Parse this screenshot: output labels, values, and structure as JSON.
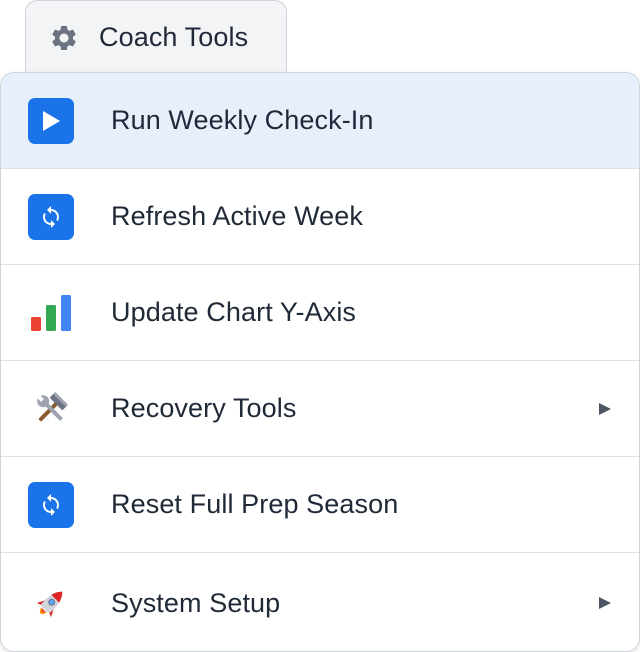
{
  "menu": {
    "title": "Coach Tools",
    "icon": "gear-icon"
  },
  "items": [
    {
      "label": "Run Weekly Check-In",
      "icon": "play-icon",
      "submenu": false,
      "highlighted": true
    },
    {
      "label": "Refresh Active Week",
      "icon": "refresh-icon",
      "submenu": false,
      "highlighted": false
    },
    {
      "label": "Update Chart Y-Axis",
      "icon": "bar-chart-icon",
      "submenu": false,
      "highlighted": false
    },
    {
      "label": "Recovery Tools",
      "icon": "hammer-wrench-icon",
      "submenu": true,
      "highlighted": false
    },
    {
      "label": "Reset Full Prep Season",
      "icon": "refresh-icon",
      "submenu": false,
      "highlighted": false
    },
    {
      "label": "System Setup",
      "icon": "rocket-icon",
      "submenu": true,
      "highlighted": false
    }
  ],
  "colors": {
    "accent": "#1a73e8",
    "highlight": "#e8effc",
    "chart_red": "#ea4335",
    "chart_green": "#34a853",
    "chart_blue": "#4285f4"
  }
}
